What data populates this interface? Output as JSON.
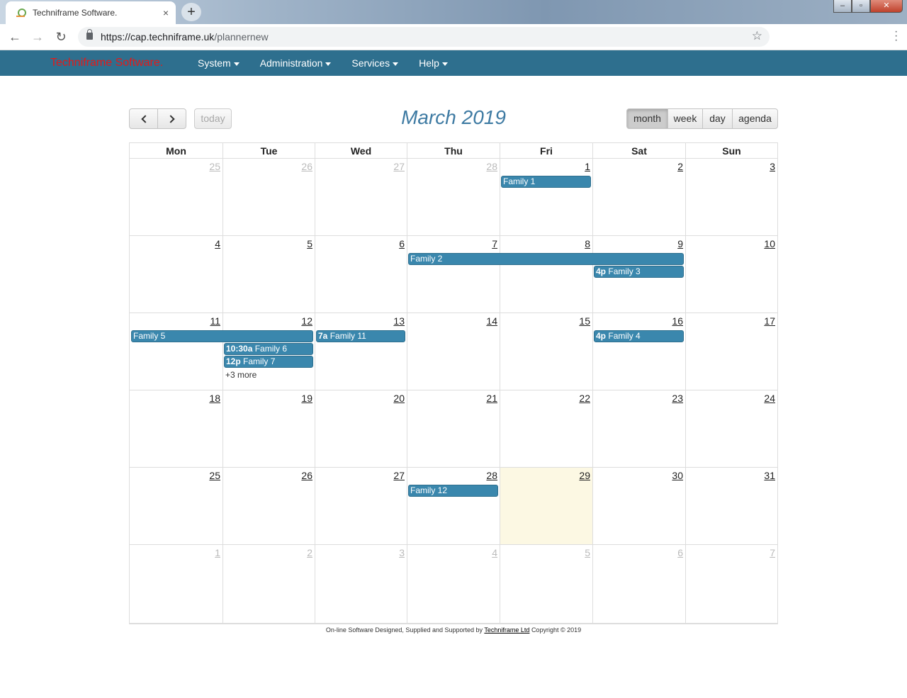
{
  "browser": {
    "tab_title": "Techniframe Software.",
    "tab_close": "×",
    "new_tab": "+",
    "url_host": "https://cap.techniframe.uk",
    "url_path": "/plannernew",
    "back": "←",
    "forward": "→",
    "reload": "↻",
    "star": "☆"
  },
  "app": {
    "brand": "Techniframe Software.",
    "menu": [
      "System",
      "Administration",
      "Services",
      "Help"
    ]
  },
  "calendar": {
    "title": "March 2019",
    "today_label": "today",
    "views": [
      "month",
      "week",
      "day",
      "agenda"
    ],
    "active_view": "month",
    "days_of_week": [
      "Mon",
      "Tue",
      "Wed",
      "Thu",
      "Fri",
      "Sat",
      "Sun"
    ],
    "weeks": [
      [
        "25",
        "26",
        "27",
        "28",
        "1",
        "2",
        "3"
      ],
      [
        "4",
        "5",
        "6",
        "7",
        "8",
        "9",
        "10"
      ],
      [
        "11",
        "12",
        "13",
        "14",
        "15",
        "16",
        "17"
      ],
      [
        "18",
        "19",
        "20",
        "21",
        "22",
        "23",
        "24"
      ],
      [
        "25",
        "26",
        "27",
        "28",
        "29",
        "30",
        "31"
      ],
      [
        "1",
        "2",
        "3",
        "4",
        "5",
        "6",
        "7"
      ]
    ],
    "events": [
      {
        "time": "",
        "title": "Family 1"
      },
      {
        "time": "",
        "title": "Family 2"
      },
      {
        "time": "4p",
        "title": "Family 3"
      },
      {
        "time": "",
        "title": "Family 5"
      },
      {
        "time": "10:30a",
        "title": "Family 6"
      },
      {
        "time": "12p",
        "title": "Family 7"
      },
      {
        "time": "7a",
        "title": "Family 11"
      },
      {
        "time": "4p",
        "title": "Family 4"
      },
      {
        "time": "",
        "title": "Family 12"
      }
    ],
    "more_label": "+3 more"
  },
  "footer": {
    "prefix": "On-line Software Designed, Supplied and Supported by",
    "link": "Techniframe Ltd",
    "suffix": "Copyright © 2019"
  },
  "colors": {
    "nav_bg": "#2e6f8e",
    "brand": "#e21a1a",
    "event_bg": "#3a87ad",
    "title": "#3f7ba3",
    "today_bg": "#fcf8e3"
  }
}
